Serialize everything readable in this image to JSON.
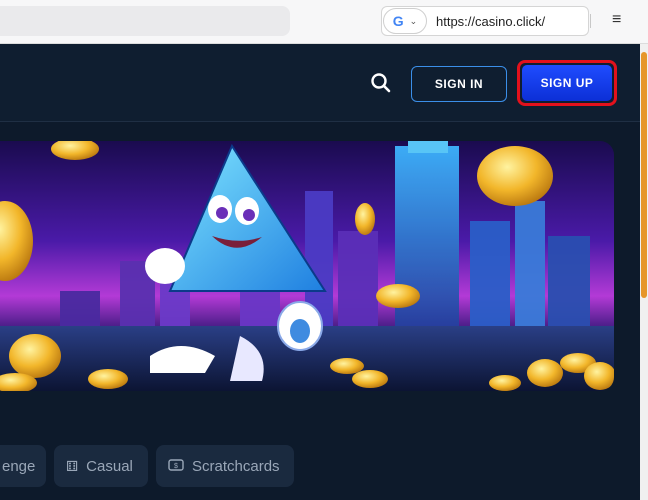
{
  "browser": {
    "url": "https://casino.click/",
    "search_engine_letter": "G",
    "chevron": "⌄",
    "menu_glyph": "≡"
  },
  "header": {
    "sign_in_label": "SIGN IN",
    "sign_up_label": "SIGN UP",
    "search_icon": "search-icon"
  },
  "categories": [
    {
      "label": "enge",
      "icon": ""
    },
    {
      "label": "Casual",
      "icon": "dice-icon"
    },
    {
      "label": "Scratchcards",
      "icon": "ticket-icon"
    }
  ],
  "colors": {
    "sign_up_bg": "#1f4cff",
    "sign_in_border": "#3b8fe8",
    "highlight_ring": "#e3111c",
    "scroll_thumb": "#e6962a",
    "page_bg": "#0d1a2b"
  }
}
